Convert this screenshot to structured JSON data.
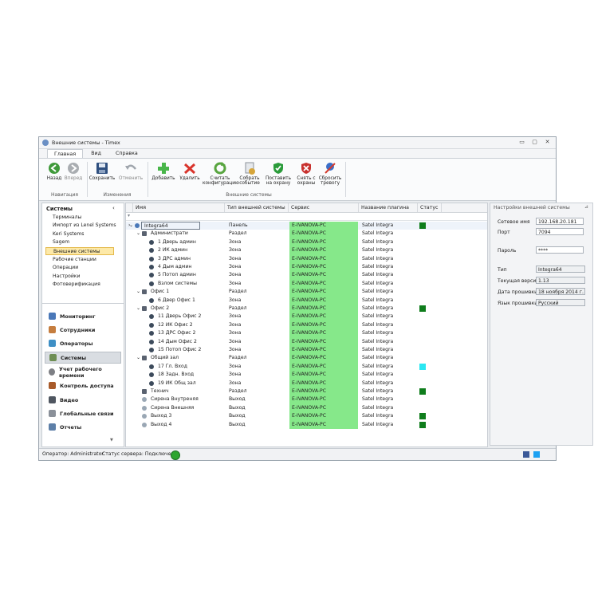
{
  "window": {
    "title": "Внешние системы - Timex"
  },
  "tabs": [
    "Главная",
    "Вид",
    "Справка"
  ],
  "ribbon": {
    "back": "Назад",
    "forward": "Вперед",
    "group_nav": "Навигация",
    "save": "Сохранить",
    "cancel": "Отменить",
    "group_changes": "Изменения",
    "add": "Добавить",
    "delete": "Удалить",
    "read_config_1": "Считать",
    "read_config_2": "конфигурацию",
    "collect_event_1": "Собрать",
    "collect_event_2": "событие",
    "arm_1": "Поставить",
    "arm_2": "на охрану",
    "disarm_1": "Снять с",
    "disarm_2": "охраны",
    "reset_alarm_1": "Сбросить",
    "reset_alarm_2": "тревогу",
    "group_ext": "Внешние системы"
  },
  "left": {
    "header": "Системы",
    "items": [
      "Терминалы",
      "Импорт из Lenel Systems",
      "Keri Systems",
      "Sagem",
      "Внешние системы",
      "Рабочие станции",
      "Операции",
      "Настройки",
      "Фотоверификация"
    ],
    "nav": [
      "Мониторинг",
      "Сотрудники",
      "Операторы",
      "Системы",
      "Учет рабочего времени",
      "Контроль доступа",
      "Видео",
      "Глобальные связи",
      "Отчеты"
    ]
  },
  "grid": {
    "columns": [
      "Имя",
      "Тип внешней системы",
      "Сервис",
      "Название плагина",
      "Статус"
    ],
    "rows": [
      {
        "name": "Integra64",
        "type": "Панель",
        "service": "E-IVANOVA-PC",
        "plugin": "Satel Integra",
        "status": "green",
        "level": 0,
        "icon": "panel"
      },
      {
        "name": "Администрати",
        "type": "Раздел",
        "service": "E-IVANOVA-PC",
        "plugin": "Satel Integra",
        "status": "",
        "level": 1,
        "icon": "partition"
      },
      {
        "name": "1 Дверь админ",
        "type": "Зона",
        "service": "E-IVANOVA-PC",
        "plugin": "Satel Integra",
        "status": "",
        "level": 2,
        "icon": "zone"
      },
      {
        "name": "2 ИК админ",
        "type": "Зона",
        "service": "E-IVANOVA-PC",
        "plugin": "Satel Integra",
        "status": "",
        "level": 2,
        "icon": "zone"
      },
      {
        "name": "3 ДРС админ",
        "type": "Зона",
        "service": "E-IVANOVA-PC",
        "plugin": "Satel Integra",
        "status": "",
        "level": 2,
        "icon": "zone"
      },
      {
        "name": "4 Дым админ",
        "type": "Зона",
        "service": "E-IVANOVA-PC",
        "plugin": "Satel Integra",
        "status": "",
        "level": 2,
        "icon": "zone"
      },
      {
        "name": "5 Потоп админ",
        "type": "Зона",
        "service": "E-IVANOVA-PC",
        "plugin": "Satel Integra",
        "status": "",
        "level": 2,
        "icon": "zone"
      },
      {
        "name": "Взлом системы",
        "type": "Зона",
        "service": "E-IVANOVA-PC",
        "plugin": "Satel Integra",
        "status": "",
        "level": 2,
        "icon": "zone"
      },
      {
        "name": "Офис 1",
        "type": "Раздел",
        "service": "E-IVANOVA-PC",
        "plugin": "Satel Integra",
        "status": "",
        "level": 1,
        "icon": "partition"
      },
      {
        "name": "6 Двер Офис 1",
        "type": "Зона",
        "service": "E-IVANOVA-PC",
        "plugin": "Satel Integra",
        "status": "",
        "level": 2,
        "icon": "zone"
      },
      {
        "name": "Офис 2",
        "type": "Раздел",
        "service": "E-IVANOVA-PC",
        "plugin": "Satel Integra",
        "status": "green",
        "level": 1,
        "icon": "partition"
      },
      {
        "name": "11 Дверь Офис 2",
        "type": "Зона",
        "service": "E-IVANOVA-PC",
        "plugin": "Satel Integra",
        "status": "",
        "level": 2,
        "icon": "zone"
      },
      {
        "name": "12 ИК Офис 2",
        "type": "Зона",
        "service": "E-IVANOVA-PC",
        "plugin": "Satel Integra",
        "status": "",
        "level": 2,
        "icon": "zone"
      },
      {
        "name": "13 ДРС Офис 2",
        "type": "Зона",
        "service": "E-IVANOVA-PC",
        "plugin": "Satel Integra",
        "status": "",
        "level": 2,
        "icon": "zone"
      },
      {
        "name": "14 Дым Офис 2",
        "type": "Зона",
        "service": "E-IVANOVA-PC",
        "plugin": "Satel Integra",
        "status": "",
        "level": 2,
        "icon": "zone"
      },
      {
        "name": "15 Потоп Офис 2",
        "type": "Зона",
        "service": "E-IVANOVA-PC",
        "plugin": "Satel Integra",
        "status": "",
        "level": 2,
        "icon": "zone"
      },
      {
        "name": "Общий зал",
        "type": "Раздел",
        "service": "E-IVANOVA-PC",
        "plugin": "Satel Integra",
        "status": "",
        "level": 1,
        "icon": "partition"
      },
      {
        "name": "17 Гл. Вход",
        "type": "Зона",
        "service": "E-IVANOVA-PC",
        "plugin": "Satel Integra",
        "status": "cyan",
        "level": 2,
        "icon": "zone"
      },
      {
        "name": "18 Задн. Вход",
        "type": "Зона",
        "service": "E-IVANOVA-PC",
        "plugin": "Satel Integra",
        "status": "",
        "level": 2,
        "icon": "zone"
      },
      {
        "name": "19 ИК Общ зал",
        "type": "Зона",
        "service": "E-IVANOVA-PC",
        "plugin": "Satel Integra",
        "status": "",
        "level": 2,
        "icon": "zone"
      },
      {
        "name": "Технич",
        "type": "Раздел",
        "service": "E-IVANOVA-PC",
        "plugin": "Satel Integra",
        "status": "green",
        "level": 1,
        "icon": "partition"
      },
      {
        "name": "Сирена Внутреняя",
        "type": "Выход",
        "service": "E-IVANOVA-PC",
        "plugin": "Satel Integra",
        "status": "",
        "level": 1,
        "icon": "output"
      },
      {
        "name": "Сирена Внешняя",
        "type": "Выход",
        "service": "E-IVANOVA-PC",
        "plugin": "Satel Integra",
        "status": "",
        "level": 1,
        "icon": "output"
      },
      {
        "name": "Выход   3",
        "type": "Выход",
        "service": "E-IVANOVA-PC",
        "plugin": "Satel Integra",
        "status": "green",
        "level": 1,
        "icon": "output"
      },
      {
        "name": "Выход   4",
        "type": "Выход",
        "service": "E-IVANOVA-PC",
        "plugin": "Satel Integra",
        "status": "green",
        "level": 1,
        "icon": "output"
      }
    ]
  },
  "right": {
    "header": "Настройки внешней системы",
    "network_name_label": "Сетевое имя",
    "network_name": "192.168.20.181",
    "port_label": "Порт",
    "port": "7094",
    "password_label": "Пароль",
    "password": "****",
    "type_label": "Тип",
    "type": "Integra64",
    "version_label": "Текущая версия",
    "version": "1.13",
    "fw_date_label": "Дата прошивки",
    "fw_date": "18 ноября 2014 г.",
    "fw_lang_label": "Язык прошивки",
    "fw_lang": "Русский"
  },
  "status": {
    "operator": "Оператор: Administrator",
    "server": "Статус сервера: Подключено"
  },
  "colors": {
    "service_bg": "#86e88a",
    "status_green": "#0f7d1c",
    "status_cyan": "#2ae7f2",
    "selection": "#fde9a8"
  }
}
